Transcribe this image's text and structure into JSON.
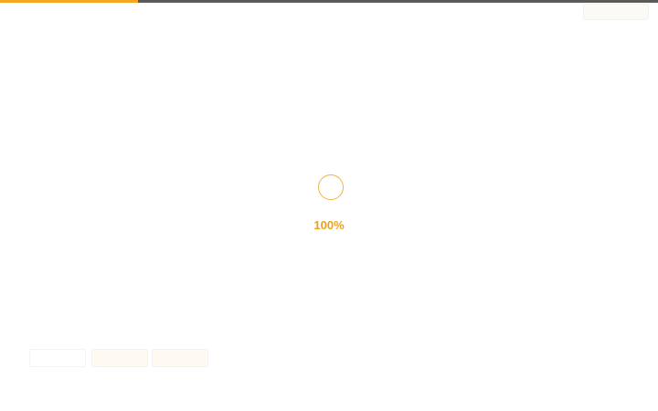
{
  "loader": {
    "percent_text": "100%",
    "progress_fraction": 0.21
  },
  "colors": {
    "accent": "#f5a623",
    "track": "#5a5a5a",
    "background": "#ffffff"
  },
  "icons": {
    "loader": "loading-ring-icon"
  }
}
